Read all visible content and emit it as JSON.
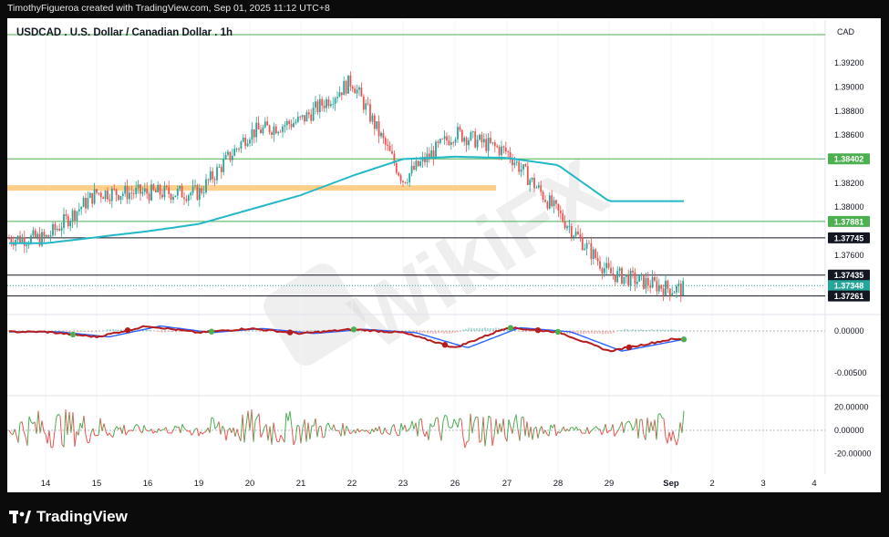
{
  "header": {
    "attribution": "TimothyFigueroa created with TradingView.com, Sep 01, 2025 11:12 UTC+8"
  },
  "chart_title": "USDCAD . U.S. Dollar / Canadian Dollar . 1h",
  "brand": {
    "name": "TradingView",
    "icon": "tradingview-logo-icon"
  },
  "watermark": "WikiFX",
  "colors": {
    "up": "#26a69a",
    "down": "#ef5350",
    "ma": "#22b8c8",
    "zone": "#ffcf8a",
    "green_line": "#4caf50",
    "black_line": "#131722",
    "macd_green": "#4caf50",
    "macd_red": "#b71c1c",
    "macd_blue": "#2962ff"
  },
  "chart_data": [
    {
      "type": "line",
      "panel": "price",
      "currency_label": "CAD",
      "ylim": [
        1.3716,
        1.3942
      ],
      "y_ticks": [
        "1.39200",
        "1.39000",
        "1.38800",
        "1.38600",
        "1.38200",
        "1.38000",
        "1.37600"
      ],
      "x_tick_labels": [
        "14",
        "15",
        "16",
        "19",
        "20",
        "21",
        "22",
        "23",
        "26",
        "27",
        "28",
        "29",
        "Sep",
        "2",
        "3",
        "4"
      ],
      "close_series_approx": {
        "x": [
          "14",
          "15",
          "16",
          "19",
          "20",
          "21",
          "22",
          "23",
          "26",
          "27",
          "28",
          "29",
          "Sep"
        ],
        "values": [
          1.3774,
          1.3812,
          1.3812,
          1.3812,
          1.3862,
          1.3872,
          1.3905,
          1.3823,
          1.3862,
          1.3846,
          1.3795,
          1.3745,
          1.3732
        ]
      },
      "moving_average_approx": {
        "x": [
          "14",
          "15",
          "16",
          "19",
          "20",
          "21",
          "22",
          "23",
          "26",
          "27",
          "28",
          "29"
        ],
        "values": [
          1.377,
          1.3775,
          1.378,
          1.3786,
          1.3798,
          1.381,
          1.3826,
          1.384,
          1.3842,
          1.3841,
          1.3835,
          1.3805
        ]
      },
      "horizontal_levels": [
        {
          "value": 1.38402,
          "label": "1.38402",
          "style": "green"
        },
        {
          "value": 1.37881,
          "label": "1.37881",
          "style": "green"
        },
        {
          "value": 1.37745,
          "label": "1.37745",
          "style": "black"
        },
        {
          "value": 1.37435,
          "label": "1.37435",
          "style": "black"
        },
        {
          "value": 1.37348,
          "label": "1.37348",
          "style": "current"
        },
        {
          "value": 1.37261,
          "label": "1.37261",
          "style": "black"
        }
      ],
      "zone": {
        "value": 1.3816,
        "from": "14",
        "to": "26"
      }
    },
    {
      "type": "line",
      "panel": "macd",
      "y_ticks": [
        "0.00000",
        "-0.00500"
      ],
      "ylim": [
        -0.0075,
        0.0012
      ],
      "macd_approx": {
        "x": [
          "14",
          "15",
          "16",
          "19",
          "20",
          "21",
          "22",
          "23",
          "26",
          "27",
          "28",
          "29",
          "Sep"
        ],
        "values": [
          -0.0001,
          -0.0007,
          0.0006,
          -0.0002,
          0.0003,
          -0.0003,
          0.0002,
          -0.0002,
          -0.002,
          0.0004,
          -0.0001,
          -0.0024,
          -0.001
        ]
      }
    },
    {
      "type": "line",
      "panel": "oscillator",
      "y_ticks": [
        "20.00000",
        "0.00000",
        "-20.00000"
      ],
      "ylim": [
        -28,
        28
      ]
    }
  ]
}
